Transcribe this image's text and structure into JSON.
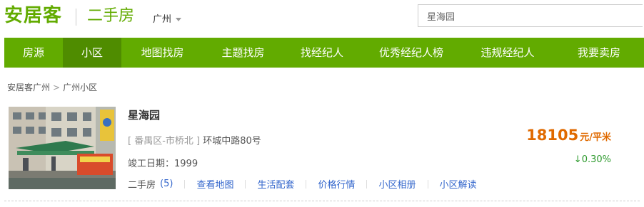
{
  "header": {
    "logo": "安居客",
    "channel": "二手房",
    "city": "广州",
    "search_value": "星海园"
  },
  "nav": {
    "items": [
      {
        "label": "房源",
        "active": false
      },
      {
        "label": "小区",
        "active": true
      },
      {
        "label": "地图找房",
        "active": false
      },
      {
        "label": "主题找房",
        "active": false
      },
      {
        "label": "找经纪人",
        "active": false
      },
      {
        "label": "优秀经纪人榜",
        "active": false
      },
      {
        "label": "违规经纪人",
        "active": false
      },
      {
        "label": "我要卖房",
        "active": false
      }
    ]
  },
  "breadcrumb": {
    "items": [
      "安居客广州",
      "广州小区"
    ],
    "separator": ">"
  },
  "community": {
    "name": "星海园",
    "district": "[ 番禺区-市桥北 ]",
    "address": "环城中路80号",
    "completion_label": "竣工日期：",
    "completion_year": "1999",
    "price": "18105",
    "price_unit": "元/平米",
    "change": "↓0.30%"
  },
  "links": {
    "second_hand_label": "二手房",
    "second_hand_count": "(5)",
    "items": [
      "查看地图",
      "生活配套",
      "价格行情",
      "小区相册",
      "小区解读"
    ]
  },
  "colors": {
    "brand_green": "#62ab00",
    "nav_active": "#4f8c00",
    "price_orange": "#e06a00",
    "down_green": "#2e9a2e",
    "link_blue": "#3366cc"
  }
}
